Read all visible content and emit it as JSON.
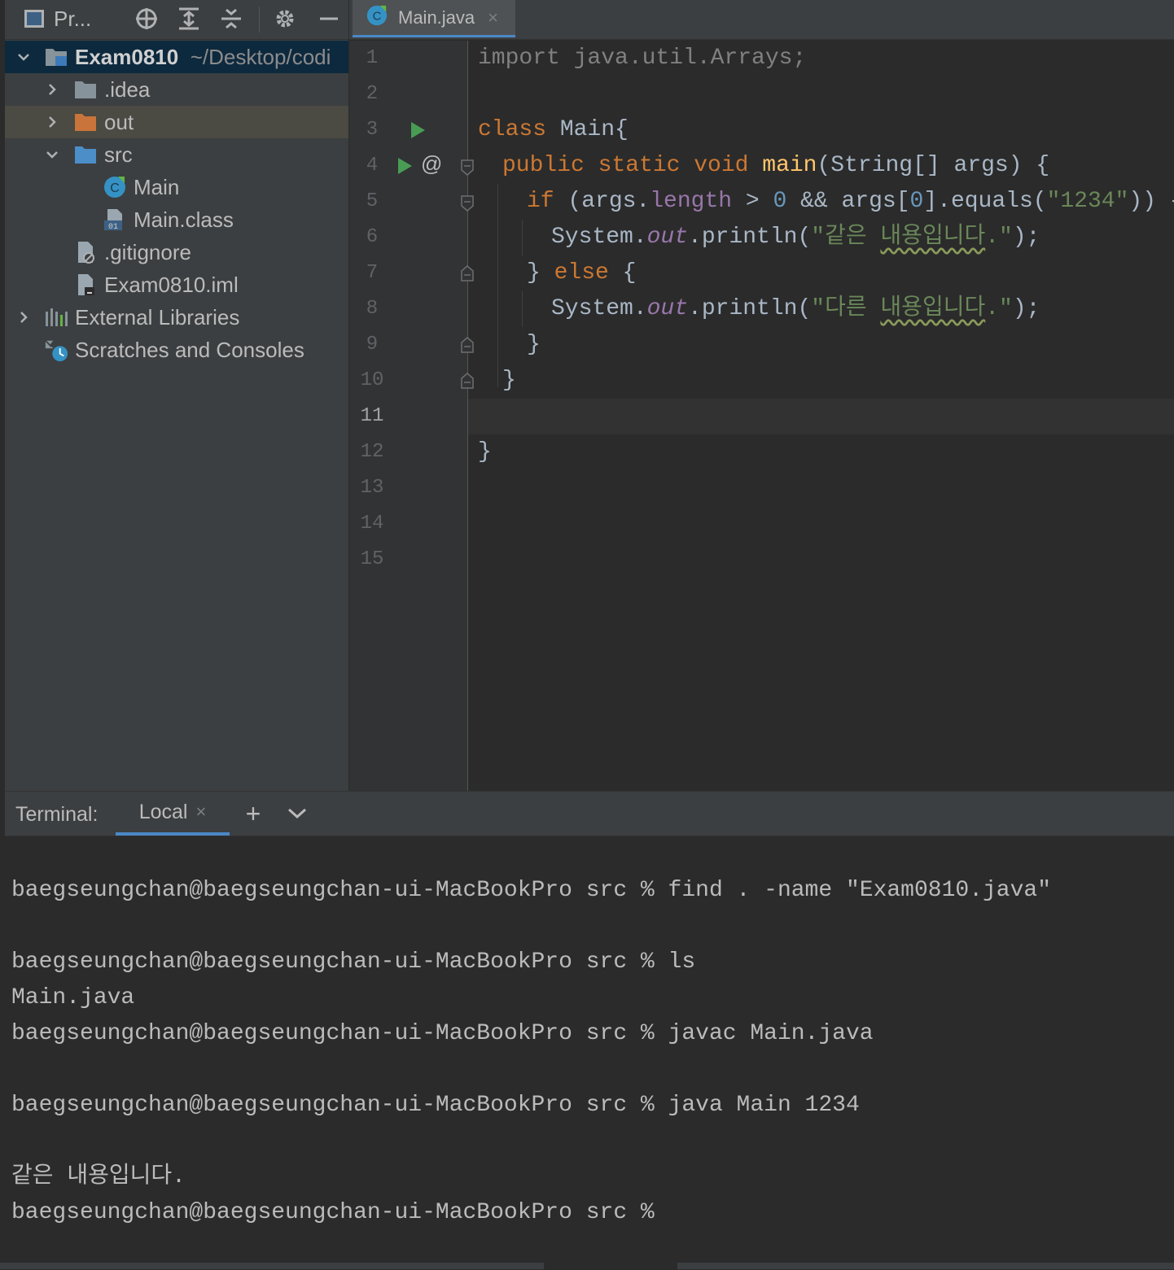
{
  "project_panel": {
    "title": "Pr...",
    "tree": {
      "root": {
        "name": "Exam0810",
        "path": "~/Desktop/codi"
      },
      "idea": ".idea",
      "out": "out",
      "src": "src",
      "main": "Main",
      "main_class": "Main.class",
      "gitignore": ".gitignore",
      "iml": "Exam0810.iml",
      "external_libraries": "External Libraries",
      "scratches": "Scratches and Consoles"
    }
  },
  "editor": {
    "tab": {
      "label": "Main.java",
      "close": "×"
    },
    "line_numbers": [
      "1",
      "2",
      "3",
      "4",
      "5",
      "6",
      "7",
      "8",
      "9",
      "10",
      "11",
      "12",
      "13",
      "14",
      "15"
    ],
    "current_line": "11",
    "gutter_at": "@",
    "code": {
      "l1": "import java.util.Arrays;",
      "l3_kw": "class",
      "l3_rest": " Main{",
      "l4_kw": "public static void",
      "l4_fn": "main",
      "l4_rest": "(String[] args) {",
      "l5_kw": "if",
      "l5_a": " (args.",
      "l5_field": "length",
      "l5_b": " > ",
      "l5_num": "0",
      "l5_c": " && args[",
      "l5_idx": "0",
      "l5_d": "].equals(",
      "l5_str": "\"1234\"",
      "l5_e": ")) {",
      "l6_a": "System.",
      "l6_out": "out",
      "l6_b": ".println(",
      "l6_str1": "\"같은 ",
      "l6_str2": "내용입니다",
      "l6_str3": ".\"",
      "l6_c": ");",
      "l7_a": "} ",
      "l7_kw": "else",
      "l7_b": " {",
      "l8_a": "System.",
      "l8_out": "out",
      "l8_b": ".println(",
      "l8_str1": "\"다른 ",
      "l8_str2": "내용입니다",
      "l8_str3": ".\"",
      "l8_c": ");",
      "l9": "}",
      "l10": "}",
      "l12": "}"
    }
  },
  "terminal": {
    "title": "Terminal:",
    "tab": "Local",
    "tab_close": "×",
    "add": "+",
    "lines": [
      "baegseungchan@baegseungchan-ui-MacBookPro src % find . -name \"Exam0810.java\"",
      "baegseungchan@baegseungchan-ui-MacBookPro src % ls",
      "Main.java",
      "baegseungchan@baegseungchan-ui-MacBookPro src % javac Main.java",
      "baegseungchan@baegseungchan-ui-MacBookPro src % java Main 1234",
      "같은 내용입니다.",
      "baegseungchan@baegseungchan-ui-MacBookPro src %"
    ]
  },
  "colors": {
    "keyword": "#cc7832",
    "function": "#ffc66d",
    "string": "#6a8759",
    "number": "#6897bb",
    "field": "#9876aa",
    "accent": "#4a88c7"
  },
  "icons": [
    "project-view-icon",
    "locate-icon",
    "expand-all-icon",
    "collapse-all-icon",
    "gear-icon",
    "hide-icon",
    "java-class-icon",
    "run-gutter-icon",
    "fold-icon",
    "add-icon",
    "chevron-down-icon"
  ]
}
